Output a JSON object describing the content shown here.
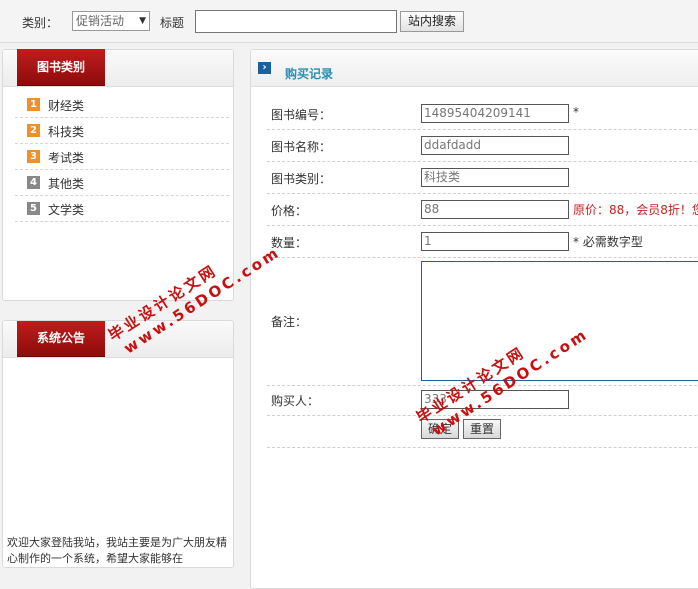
{
  "topbar": {
    "category_label": "类别：",
    "category_selected": "促销活动",
    "title_label": "标题",
    "title_value": "",
    "search_button": "站内搜索"
  },
  "categories_panel": {
    "title": "图书类别",
    "items": [
      {
        "num": "1",
        "label": "财经类"
      },
      {
        "num": "2",
        "label": "科技类"
      },
      {
        "num": "3",
        "label": "考试类"
      },
      {
        "num": "4",
        "label": "其他类"
      },
      {
        "num": "5",
        "label": "文学类"
      }
    ]
  },
  "notice_panel": {
    "title": "系统公告",
    "text": "欢迎大家登陆我站，我站主要是为广大朋友精心制作的一个系统，希望大家能够在"
  },
  "purchase_panel": {
    "title": "购买记录",
    "book_id_label": "图书编号：",
    "book_id_value": "14895404209141",
    "book_id_mark": "*",
    "book_name_label": "图书名称：",
    "book_name_value": "ddafdadd",
    "book_category_label": "图书类别：",
    "book_category_value": "科技类",
    "price_label": "价格：",
    "price_value": "88",
    "price_note": "原价：88，会员8折！您",
    "quantity_label": "数量：",
    "quantity_value": "1",
    "quantity_note": "* 必需数字型",
    "remark_label": "备注：",
    "remark_value": "",
    "buyer_label": "购买人：",
    "buyer_value": "333",
    "confirm_button": "确定",
    "reset_button": "重置"
  },
  "watermark": {
    "line1": "毕业设计论文网",
    "line2": "www.56DOC.com"
  },
  "colors": {
    "tab_red": "#a81414",
    "title_teal": "#2d8fae",
    "note_red": "#c82222",
    "watermark_red": "#c81010"
  }
}
